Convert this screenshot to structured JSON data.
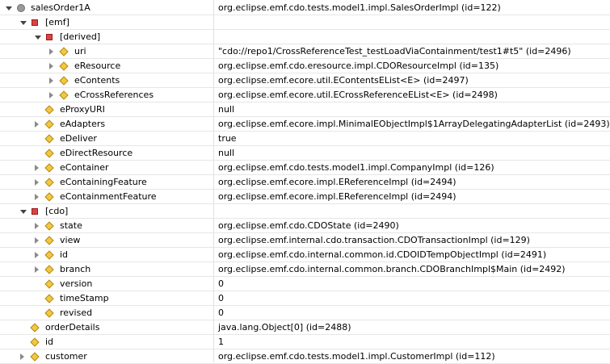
{
  "rows": [
    {
      "name": "salesOrder1A",
      "value": "org.eclipse.emf.cdo.tests.model1.impl.SalesOrderImpl  (id=122)",
      "icon": "root-object-icon",
      "open": true,
      "twisty": true,
      "depth": 0
    },
    {
      "name": "[emf]",
      "value": "",
      "icon": "group-icon",
      "open": true,
      "twisty": true,
      "depth": 1
    },
    {
      "name": "[derived]",
      "value": "",
      "icon": "group-icon",
      "open": true,
      "twisty": true,
      "depth": 2
    },
    {
      "name": "uri",
      "value": "\"cdo://repo1/CrossReferenceTest_testLoadViaContainment/test1#t5\" (id=2496)",
      "icon": "property-icon",
      "open": false,
      "twisty": true,
      "depth": 3
    },
    {
      "name": "eResource",
      "value": "org.eclipse.emf.cdo.eresource.impl.CDOResourceImpl  (id=135)",
      "icon": "property-icon",
      "open": false,
      "twisty": true,
      "depth": 3
    },
    {
      "name": "eContents",
      "value": "org.eclipse.emf.ecore.util.EContentsEList<E>  (id=2497)",
      "icon": "property-icon",
      "open": false,
      "twisty": true,
      "depth": 3
    },
    {
      "name": "eCrossReferences",
      "value": "org.eclipse.emf.ecore.util.ECrossReferenceEList<E>  (id=2498)",
      "icon": "property-icon",
      "open": false,
      "twisty": true,
      "depth": 3
    },
    {
      "name": "eProxyURI",
      "value": "null",
      "icon": "property-icon",
      "open": false,
      "twisty": false,
      "depth": 2
    },
    {
      "name": "eAdapters",
      "value": "org.eclipse.emf.ecore.impl.MinimalEObjectImpl$1ArrayDelegatingAdapterList  (id=2493)",
      "icon": "property-icon",
      "open": false,
      "twisty": true,
      "depth": 2
    },
    {
      "name": "eDeliver",
      "value": "true",
      "icon": "property-icon",
      "open": false,
      "twisty": false,
      "depth": 2
    },
    {
      "name": "eDirectResource",
      "value": "null",
      "icon": "property-icon",
      "open": false,
      "twisty": false,
      "depth": 2
    },
    {
      "name": "eContainer",
      "value": "org.eclipse.emf.cdo.tests.model1.impl.CompanyImpl  (id=126)",
      "icon": "property-icon",
      "open": false,
      "twisty": true,
      "depth": 2
    },
    {
      "name": "eContainingFeature",
      "value": "org.eclipse.emf.ecore.impl.EReferenceImpl  (id=2494)",
      "icon": "property-icon",
      "open": false,
      "twisty": true,
      "depth": 2
    },
    {
      "name": "eContainmentFeature",
      "value": "org.eclipse.emf.ecore.impl.EReferenceImpl  (id=2494)",
      "icon": "property-icon",
      "open": false,
      "twisty": true,
      "depth": 2
    },
    {
      "name": "[cdo]",
      "value": "",
      "icon": "group-icon",
      "open": true,
      "twisty": true,
      "depth": 1
    },
    {
      "name": "state",
      "value": "org.eclipse.emf.cdo.CDOState  (id=2490)",
      "icon": "property-icon",
      "open": false,
      "twisty": true,
      "depth": 2
    },
    {
      "name": "view",
      "value": "org.eclipse.emf.internal.cdo.transaction.CDOTransactionImpl  (id=129)",
      "icon": "property-icon",
      "open": false,
      "twisty": true,
      "depth": 2
    },
    {
      "name": "id",
      "value": "org.eclipse.emf.cdo.internal.common.id.CDOIDTempObjectImpl  (id=2491)",
      "icon": "property-icon",
      "open": false,
      "twisty": true,
      "depth": 2
    },
    {
      "name": "branch",
      "value": "org.eclipse.emf.cdo.internal.common.branch.CDOBranchImpl$Main  (id=2492)",
      "icon": "property-icon",
      "open": false,
      "twisty": true,
      "depth": 2
    },
    {
      "name": "version",
      "value": "0",
      "icon": "property-icon",
      "open": false,
      "twisty": false,
      "depth": 2
    },
    {
      "name": "timeStamp",
      "value": "0",
      "icon": "property-icon",
      "open": false,
      "twisty": false,
      "depth": 2
    },
    {
      "name": "revised",
      "value": "0",
      "icon": "property-icon",
      "open": false,
      "twisty": false,
      "depth": 2
    },
    {
      "name": "orderDetails",
      "value": "java.lang.Object[0]  (id=2488)",
      "icon": "property-icon",
      "open": false,
      "twisty": false,
      "depth": 1
    },
    {
      "name": "id",
      "value": "1",
      "icon": "property-icon",
      "open": false,
      "twisty": false,
      "depth": 1
    },
    {
      "name": "customer",
      "value": "org.eclipse.emf.cdo.tests.model1.impl.CustomerImpl  (id=112)",
      "icon": "property-icon",
      "open": false,
      "twisty": true,
      "depth": 1
    }
  ]
}
